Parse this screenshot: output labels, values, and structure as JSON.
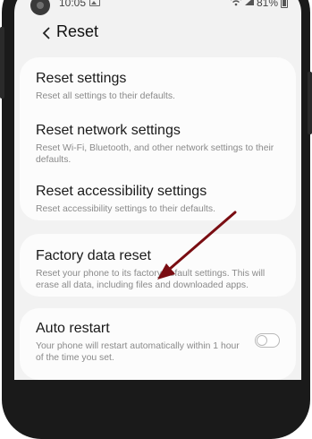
{
  "status_bar": {
    "time": "10:05",
    "battery": "81%"
  },
  "header": {
    "title": "Reset"
  },
  "settings": {
    "reset_settings": {
      "title": "Reset settings",
      "description": "Reset all settings to their defaults."
    },
    "reset_network": {
      "title": "Reset network settings",
      "description": "Reset Wi-Fi, Bluetooth, and other network settings to their defaults."
    },
    "reset_accessibility": {
      "title": "Reset accessibility settings",
      "description": "Reset accessibility settings to their defaults."
    },
    "factory_reset": {
      "title": "Factory data reset",
      "description": "Reset your phone to its factory default settings. This will erase all data, including files and downloaded apps."
    },
    "auto_restart": {
      "title": "Auto restart",
      "description": "Your phone will restart automatically within 1 hour of the time you set.",
      "enabled": false
    }
  },
  "annotation": {
    "arrow_color": "#7a0d12"
  },
  "colors": {
    "screen_bg": "#f2f2f2",
    "card_bg": "#fcfcfc",
    "phone_frame": "#1a1a1a"
  }
}
